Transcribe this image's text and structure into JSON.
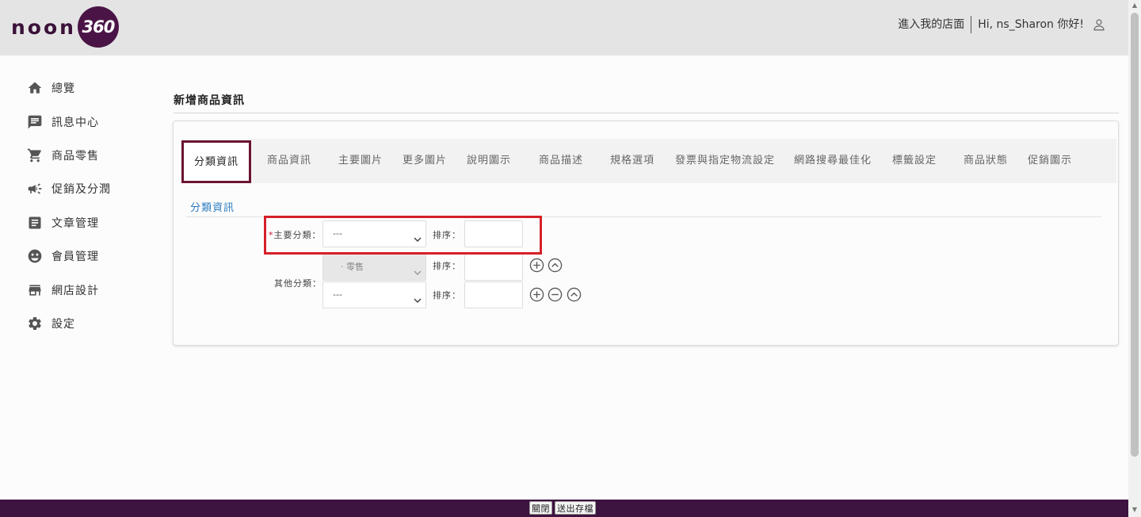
{
  "header": {
    "logo_text": "noon",
    "logo_badge": "360",
    "store_link": "進入我的店面",
    "greeting": "Hi, ns_Sharon 你好!"
  },
  "sidebar": {
    "items": [
      {
        "label": "總覽",
        "icon": "home-icon"
      },
      {
        "label": "訊息中心",
        "icon": "message-icon"
      },
      {
        "label": "商品零售",
        "icon": "cart-icon"
      },
      {
        "label": "促銷及分潤",
        "icon": "megaphone-icon"
      },
      {
        "label": "文章管理",
        "icon": "article-icon"
      },
      {
        "label": "會員管理",
        "icon": "member-icon"
      },
      {
        "label": "網店設計",
        "icon": "store-icon"
      },
      {
        "label": "設定",
        "icon": "gear-icon"
      }
    ]
  },
  "main": {
    "page_title": "新增商品資訊",
    "tabs": [
      {
        "label": "分類資訊",
        "active": true
      },
      {
        "label": "商品資訊"
      },
      {
        "label": "主要圖片"
      },
      {
        "label": "更多圖片"
      },
      {
        "label": "說明圖示"
      },
      {
        "label": "商品描述"
      },
      {
        "label": "規格選項"
      },
      {
        "label": "發票與指定物流設定"
      },
      {
        "label": "網路搜尋最佳化"
      },
      {
        "label": "標籤設定"
      },
      {
        "label": "商品狀態"
      },
      {
        "label": "促銷圖示"
      }
    ],
    "section_title": "分類資訊",
    "main_category": {
      "required_mark": "*",
      "label": "主要分類：",
      "value": "---",
      "sort_label": "排序："
    },
    "other_category": {
      "label": "其他分類：",
      "rows": [
        {
          "value": "· 零售",
          "disabled": true,
          "sort_label": "排序："
        },
        {
          "value": "---",
          "disabled": false,
          "sort_label": "排序："
        }
      ]
    }
  },
  "footer": {
    "close_label": "關閉",
    "submit_label": "送出存檔"
  },
  "colors": {
    "brand": "#4a1546",
    "footer": "#3d1340",
    "active_tab_border": "#6b1430",
    "highlight": "#d62027",
    "section_link": "#2a7bbf",
    "required": "#d0102c"
  }
}
